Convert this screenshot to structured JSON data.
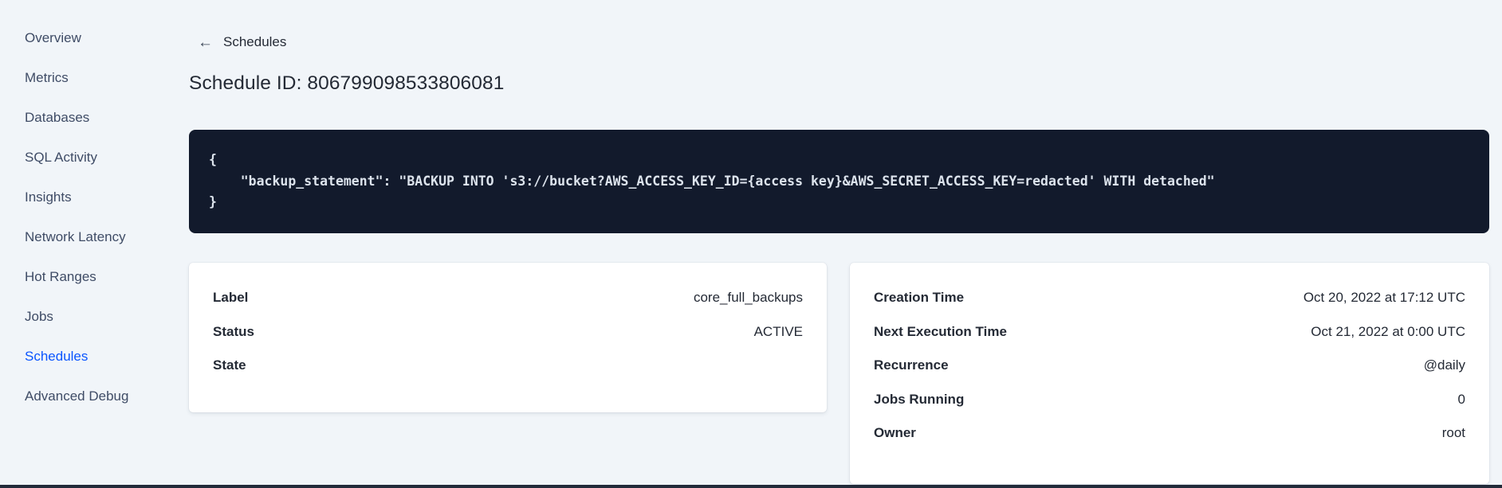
{
  "sidebar": {
    "items": [
      {
        "label": "Overview"
      },
      {
        "label": "Metrics"
      },
      {
        "label": "Databases"
      },
      {
        "label": "SQL Activity"
      },
      {
        "label": "Insights"
      },
      {
        "label": "Network Latency"
      },
      {
        "label": "Hot Ranges"
      },
      {
        "label": "Jobs"
      },
      {
        "label": "Schedules",
        "active": true
      },
      {
        "label": "Advanced Debug"
      }
    ]
  },
  "header": {
    "back_link": "Schedules",
    "title": "Schedule ID: 806799098533806081"
  },
  "icons": {
    "back_arrow": "←"
  },
  "code_block": {
    "text": "{\n    \"backup_statement\": \"BACKUP INTO 's3://bucket?AWS_ACCESS_KEY_ID={access key}&AWS_SECRET_ACCESS_KEY=redacted' WITH detached\"\n}"
  },
  "details_card": {
    "rows": [
      {
        "label": "Label",
        "value": "core_full_backups"
      },
      {
        "label": "Status",
        "value": "ACTIVE"
      },
      {
        "label": "State",
        "value": ""
      }
    ]
  },
  "schedule_card": {
    "rows": [
      {
        "label": "Creation Time",
        "value": "Oct 20, 2022 at 17:12 UTC"
      },
      {
        "label": "Next Execution Time",
        "value": "Oct 21, 2022 at 0:00 UTC"
      },
      {
        "label": "Recurrence",
        "value": "@daily"
      },
      {
        "label": "Jobs Running",
        "value": "0"
      },
      {
        "label": "Owner",
        "value": "root"
      }
    ]
  },
  "colors": {
    "background": "#f1f5f9",
    "accent_blue": "#0a55ff",
    "code_background": "#121a2c",
    "code_text": "#dce3ec",
    "text_primary": "#242a35",
    "sidebar_text": "#3f4c66"
  }
}
